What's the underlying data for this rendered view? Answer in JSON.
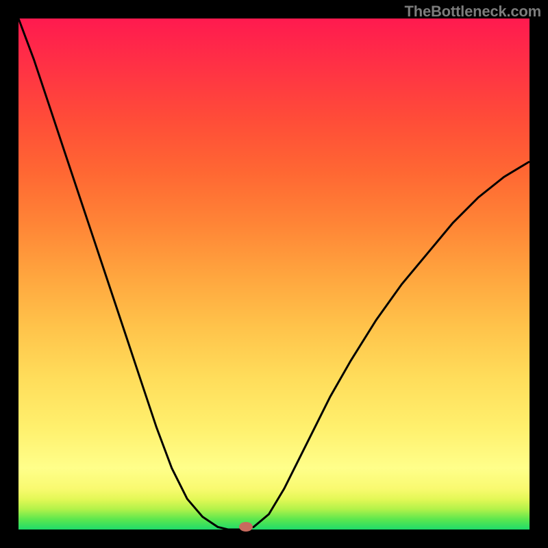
{
  "watermark": "TheBottleneck.com",
  "chart_data": {
    "type": "line",
    "title": "",
    "xlabel": "",
    "ylabel": "",
    "x": [
      0.0,
      0.03,
      0.06,
      0.09,
      0.12,
      0.15,
      0.18,
      0.21,
      0.24,
      0.27,
      0.3,
      0.33,
      0.36,
      0.39,
      0.41,
      0.435,
      0.46,
      0.49,
      0.52,
      0.55,
      0.58,
      0.61,
      0.65,
      0.7,
      0.75,
      0.8,
      0.85,
      0.9,
      0.95,
      1.0
    ],
    "values": [
      1.0,
      0.92,
      0.83,
      0.74,
      0.65,
      0.56,
      0.47,
      0.38,
      0.29,
      0.2,
      0.12,
      0.06,
      0.025,
      0.005,
      0.0,
      0.0,
      0.005,
      0.03,
      0.08,
      0.14,
      0.2,
      0.26,
      0.33,
      0.41,
      0.48,
      0.54,
      0.6,
      0.65,
      0.69,
      0.72
    ],
    "xlim": [
      0,
      1
    ],
    "ylim": [
      0,
      1
    ],
    "marker": {
      "x": 0.445,
      "y": 0.0
    },
    "background": "heatmap-gradient-green-to-red"
  }
}
